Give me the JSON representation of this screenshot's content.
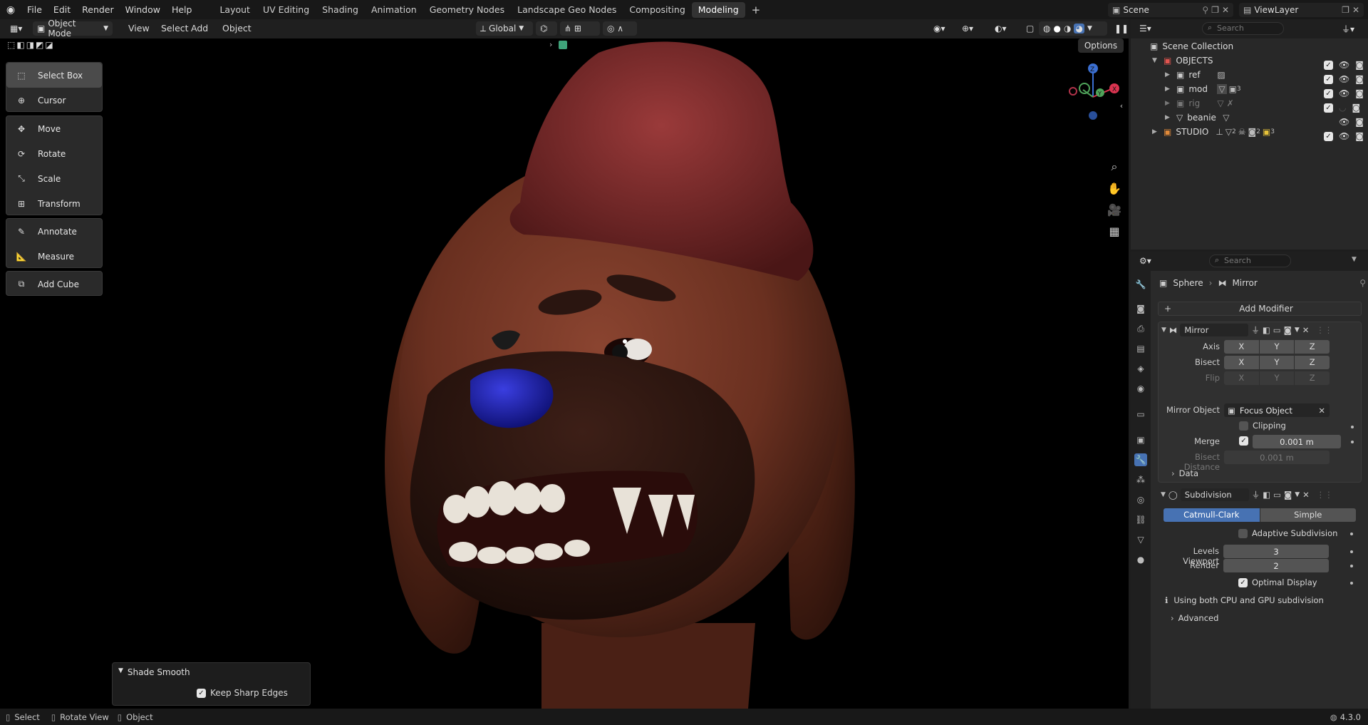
{
  "topbar": {
    "menus": [
      "File",
      "Edit",
      "Render",
      "Window",
      "Help"
    ],
    "workspace_tabs": [
      "Layout",
      "UV Editing",
      "Shading",
      "Animation",
      "Geometry Nodes",
      "Landscape Geo Nodes",
      "Compositing",
      "Modeling"
    ],
    "active_tab": "Modeling",
    "add_tab": "+",
    "scene": "Scene",
    "view_layer": "ViewLayer"
  },
  "viewport_header": {
    "mode": "Object Mode",
    "menus": [
      "View",
      "Select",
      "Add",
      "Object"
    ],
    "orientation": "Global",
    "options": "Options"
  },
  "toolbar": {
    "tools": [
      {
        "label": "Select Box",
        "icon": "select-box-icon"
      },
      {
        "label": "Cursor",
        "icon": "cursor-icon"
      },
      {
        "label": "Move",
        "icon": "move-icon"
      },
      {
        "label": "Rotate",
        "icon": "rotate-icon"
      },
      {
        "label": "Scale",
        "icon": "scale-icon"
      },
      {
        "label": "Transform",
        "icon": "transform-icon"
      },
      {
        "label": "Annotate",
        "icon": "annotate-icon"
      },
      {
        "label": "Measure",
        "icon": "measure-icon"
      },
      {
        "label": "Add Cube",
        "icon": "add-cube-icon"
      }
    ]
  },
  "gizmo": {
    "x": "X",
    "y": "Y",
    "z": "Z"
  },
  "last_op": {
    "title": "Shade Smooth",
    "option": "Keep Sharp Edges",
    "checked": true
  },
  "outliner": {
    "search_placeholder": "Search",
    "root": "Scene Collection",
    "rows": [
      {
        "name": "OBJECTS"
      },
      {
        "name": "ref"
      },
      {
        "name": "mod",
        "badge": "3"
      },
      {
        "name": "rig"
      },
      {
        "name": "beanie"
      },
      {
        "name": "STUDIO",
        "badge_a": "2",
        "badge_b": "2",
        "badge_c": "3"
      }
    ]
  },
  "properties": {
    "search_placeholder": "Search",
    "breadcrumb_object": "Sphere",
    "breadcrumb_modifier": "Mirror",
    "add_modifier": "Add Modifier",
    "mirror": {
      "name": "Mirror",
      "axis_label": "Axis",
      "bisect_label": "Bisect",
      "flip_label": "Flip",
      "xyz": [
        "X",
        "Y",
        "Z"
      ],
      "mirror_object_label": "Mirror Object",
      "mirror_object_value": "Focus Object",
      "clipping": "Clipping",
      "merge_label": "Merge",
      "merge_value": "0.001 m",
      "bisect_distance_label": "Bisect Distance",
      "bisect_distance_value": "0.001 m",
      "data_section": "Data"
    },
    "subdivision": {
      "name": "Subdivision",
      "catmull": "Catmull-Clark",
      "simple": "Simple",
      "adaptive": "Adaptive Subdivision",
      "levels_viewport_label": "Levels Viewport",
      "levels_viewport_value": "3",
      "render_label": "Render",
      "render_value": "2",
      "optimal": "Optimal Display",
      "info": "Using both CPU and GPU subdivision",
      "advanced": "Advanced"
    }
  },
  "statusbar": {
    "items": [
      "Select",
      "Rotate View",
      "Object"
    ],
    "version": "4.3.0"
  },
  "colors": {
    "accent_blue": "#4772b3",
    "beanie": "#7a2a2a",
    "dog_skin": "#6e3322",
    "nose": "#1b1fa8"
  }
}
